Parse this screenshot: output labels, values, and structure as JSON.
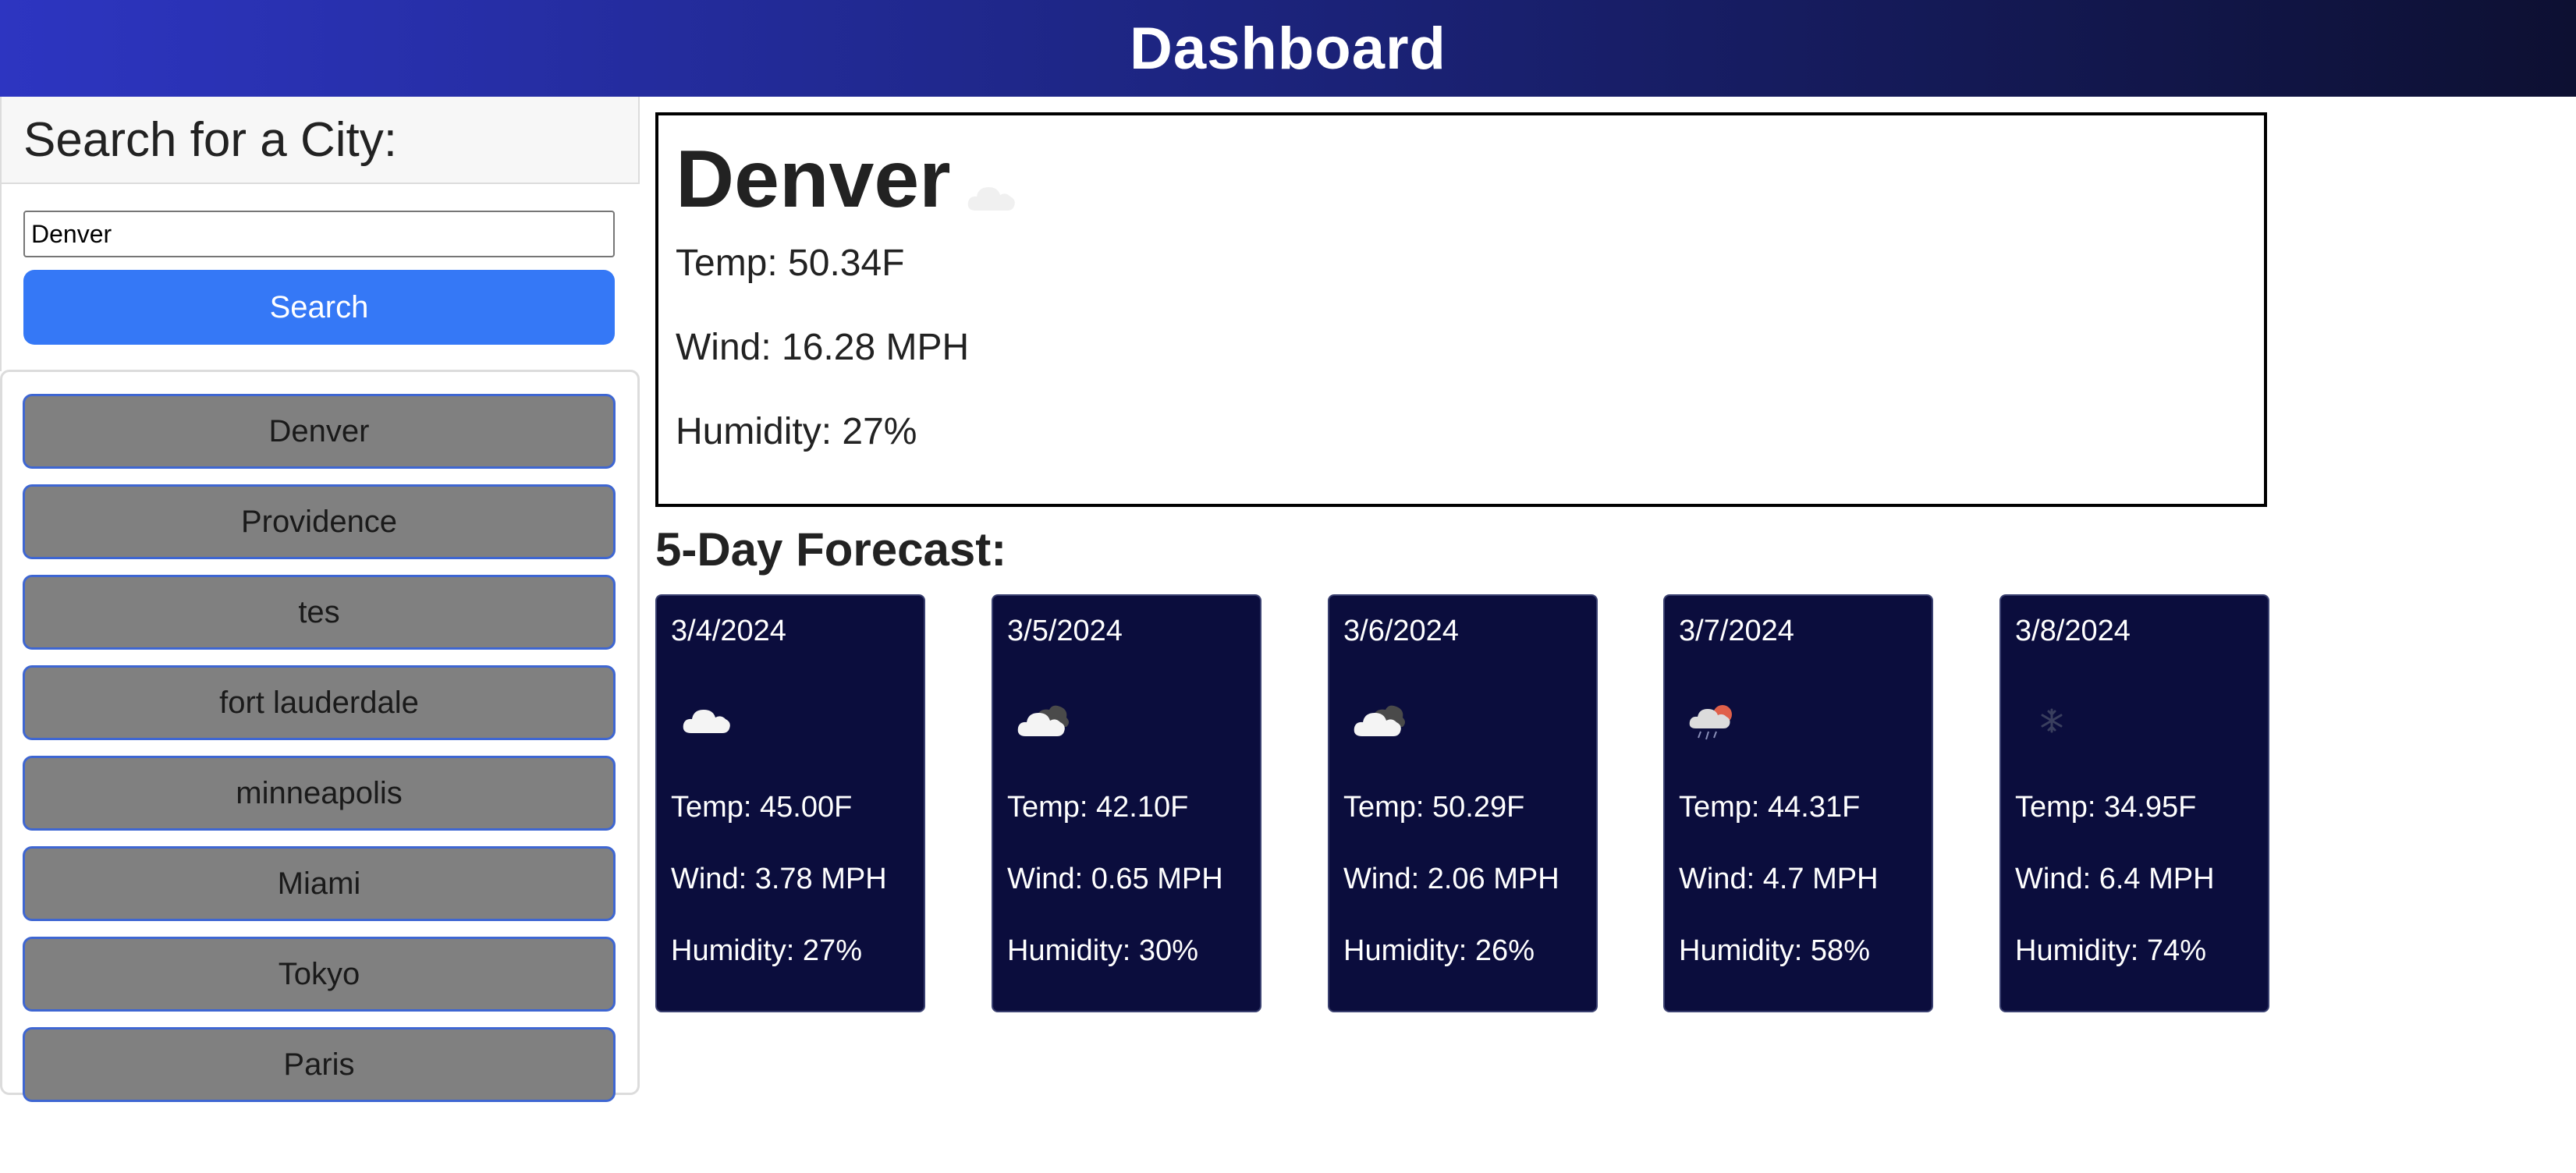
{
  "header": {
    "title": "Dashboard"
  },
  "sidebar": {
    "heading": "Search for a City:",
    "search_value": "Denver",
    "search_button_label": "Search",
    "history": [
      "Denver",
      "Providence",
      "tes",
      "fort lauderdale",
      "minneapolis",
      "Miami",
      "Tokyo",
      "Paris"
    ]
  },
  "current": {
    "city": "Denver",
    "icon": "cloud-icon",
    "temp": "Temp: 50.34F",
    "wind": "Wind: 16.28 MPH",
    "humidity": "Humidity: 27%"
  },
  "forecast": {
    "title": "5-Day Forecast:",
    "days": [
      {
        "date": "3/4/2024",
        "icon": "cloud-icon",
        "temp": "Temp: 45.00F",
        "wind": "Wind: 3.78 MPH",
        "humidity": "Humidity: 27%"
      },
      {
        "date": "3/5/2024",
        "icon": "broken-clouds-icon",
        "temp": "Temp: 42.10F",
        "wind": "Wind: 0.65 MPH",
        "humidity": "Humidity: 30%"
      },
      {
        "date": "3/6/2024",
        "icon": "broken-clouds-icon",
        "temp": "Temp: 50.29F",
        "wind": "Wind: 2.06 MPH",
        "humidity": "Humidity: 26%"
      },
      {
        "date": "3/7/2024",
        "icon": "rain-sun-icon",
        "temp": "Temp: 44.31F",
        "wind": "Wind: 4.7 MPH",
        "humidity": "Humidity: 58%"
      },
      {
        "date": "3/8/2024",
        "icon": "snow-icon",
        "temp": "Temp: 34.95F",
        "wind": "Wind: 6.4 MPH",
        "humidity": "Humidity: 74%"
      }
    ]
  },
  "colors": {
    "header_start": "#2d35c1",
    "header_end": "#0d1032",
    "search_button": "#3578f6",
    "history_button": "#808080",
    "forecast_card": "#0b0d3d"
  }
}
